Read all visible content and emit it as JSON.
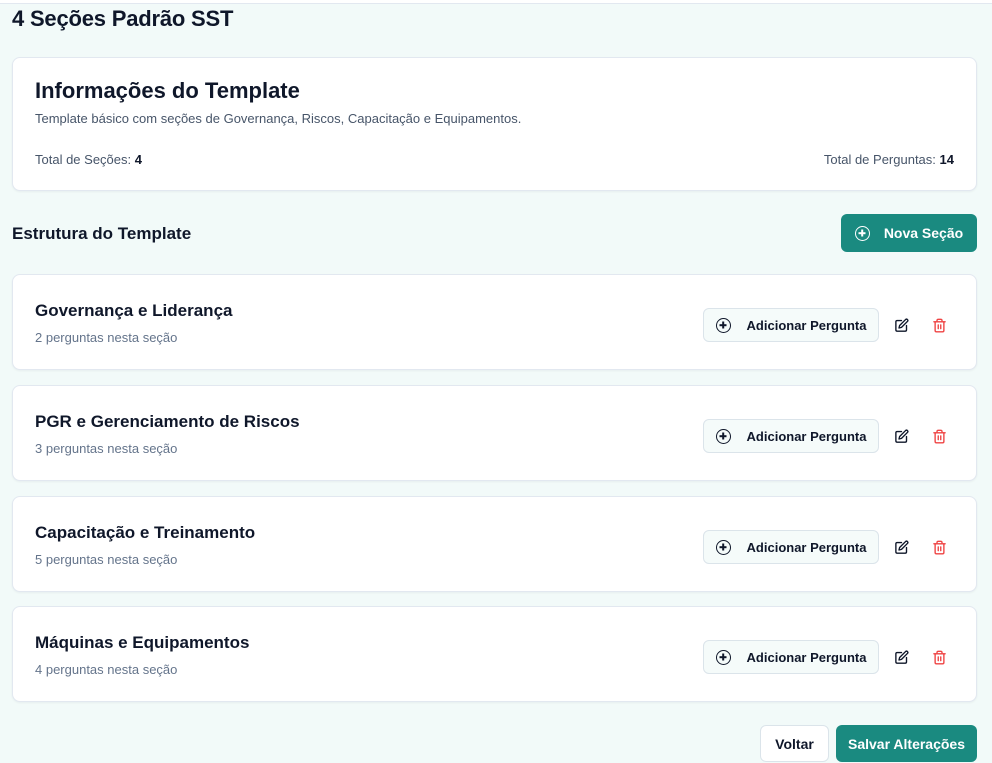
{
  "page": {
    "title": "4 Seções Padrão SST"
  },
  "info": {
    "heading": "Informações do Template",
    "description": "Template básico com seções de Governança, Riscos, Capacitação e Equipamentos.",
    "total_sections_label": "Total de Seções:",
    "total_sections_value": "4",
    "total_questions_label": "Total de Perguntas:",
    "total_questions_value": "14"
  },
  "structure": {
    "heading": "Estrutura do Template",
    "new_section_label": "Nova Seção"
  },
  "sections": [
    {
      "name": "Governança e Liderança",
      "count": "2 perguntas nesta seção",
      "add_label": "Adicionar Pergunta"
    },
    {
      "name": "PGR e Gerenciamento de Riscos",
      "count": "3 perguntas nesta seção",
      "add_label": "Adicionar Pergunta"
    },
    {
      "name": "Capacitação e Treinamento",
      "count": "5 perguntas nesta seção",
      "add_label": "Adicionar Pergunta"
    },
    {
      "name": "Máquinas e Equipamentos",
      "count": "4 perguntas nesta seção",
      "add_label": "Adicionar Pergunta"
    }
  ],
  "footer": {
    "back_label": "Voltar",
    "save_label": "Salvar Alterações"
  },
  "colors": {
    "primary": "#1a8a80",
    "danger": "#ef4444",
    "background": "#f2faf9"
  },
  "icons": {
    "add": "circle-plus-icon",
    "edit": "edit-icon",
    "delete": "trash-icon"
  }
}
